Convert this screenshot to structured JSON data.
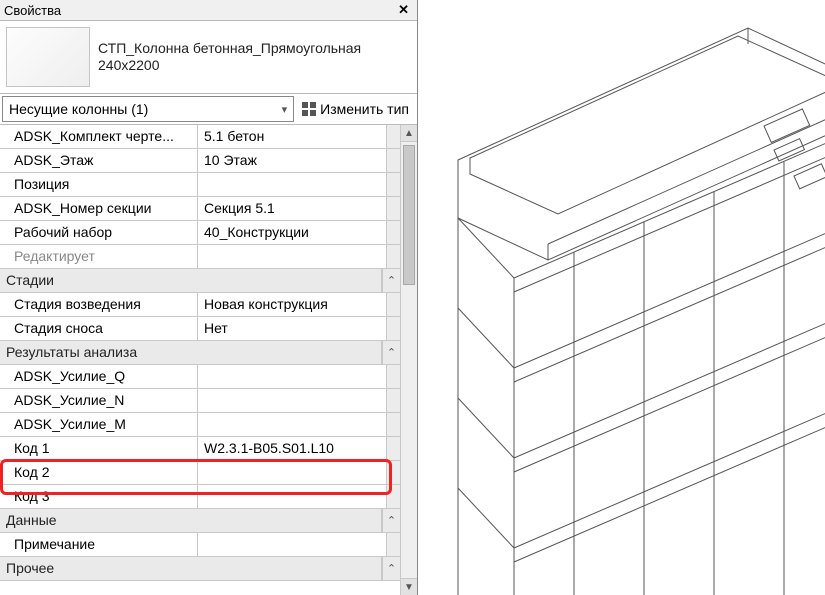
{
  "panel": {
    "title": "Свойства",
    "type_name": "СТП_Колонна бетонная_Прямоугольная",
    "type_size": "240x2200",
    "filter_label": "Несущие колонны (1)",
    "edit_type": "Изменить тип"
  },
  "groups": [
    {
      "rows": [
        {
          "label": "ADSK_Комплект черте...",
          "value": "5.1 бетон",
          "indent": true
        },
        {
          "label": "ADSK_Этаж",
          "value": "10 Этаж",
          "indent": true
        },
        {
          "label": "Позиция",
          "value": "",
          "indent": true
        },
        {
          "label": "ADSK_Номер секции",
          "value": "Секция 5.1",
          "indent": true
        },
        {
          "label": "Рабочий набор",
          "value": "40_Конструкции",
          "indent": true
        },
        {
          "label": "Редактирует",
          "value": "",
          "indent": true,
          "dim": true
        }
      ]
    },
    {
      "title": "Стадии",
      "rows": [
        {
          "label": "Стадия возведения",
          "value": "Новая конструкция",
          "indent": true
        },
        {
          "label": "Стадия сноса",
          "value": "Нет",
          "indent": true
        }
      ]
    },
    {
      "title": "Результаты анализа",
      "rows": [
        {
          "label": "ADSK_Усилие_Q",
          "value": "",
          "indent": true
        },
        {
          "label": "ADSK_Усилие_N",
          "value": "",
          "indent": true
        },
        {
          "label": "ADSK_Усилие_M",
          "value": "",
          "indent": true
        },
        {
          "label": "Код 1",
          "value": "W2.3.1-B05.S01.L10",
          "indent": true
        },
        {
          "label": "Код 2",
          "value": "",
          "indent": true
        },
        {
          "label": "Код 3",
          "value": "",
          "indent": true
        }
      ]
    },
    {
      "title": "Данные",
      "rows": [
        {
          "label": "Примечание",
          "value": "",
          "indent": true
        }
      ]
    },
    {
      "title": "Прочее",
      "rows": []
    }
  ]
}
